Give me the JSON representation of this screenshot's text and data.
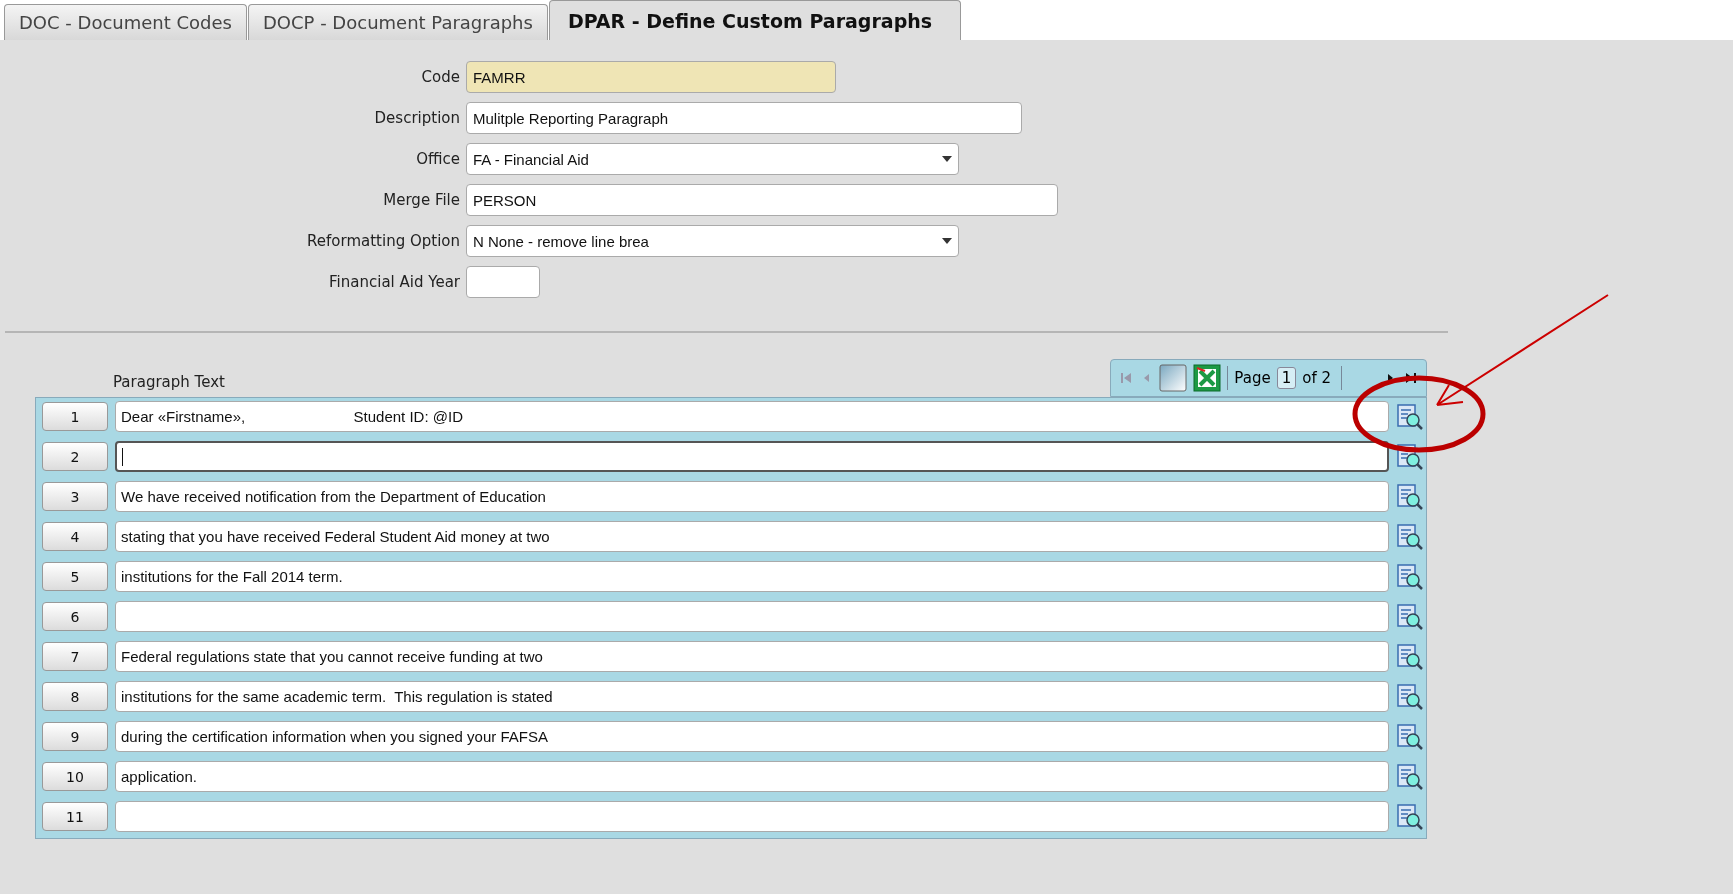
{
  "tabs": [
    {
      "label": "DOC - Document Codes",
      "selected": false
    },
    {
      "label": "DOCP - Document Paragraphs",
      "selected": false
    },
    {
      "label": "DPAR - Define Custom Paragraphs",
      "selected": true
    }
  ],
  "form": [
    {
      "label": "Code",
      "value": "FAMRR",
      "kind": "key"
    },
    {
      "label": "Description",
      "value": "Mulitple Reporting Paragraph",
      "kind": "text"
    },
    {
      "label": "Office",
      "value": "FA - Financial Aid",
      "kind": "select"
    },
    {
      "label": "Merge File",
      "value": "PERSON",
      "kind": "text"
    },
    {
      "label": "Reformatting Option",
      "value": "N None - remove line brea",
      "kind": "select"
    },
    {
      "label": "Financial Aid Year",
      "kind": "short"
    }
  ],
  "pager": {
    "label": "Page",
    "page": "1",
    "total": "of 2"
  },
  "grid": {
    "column": "Paragraph Text",
    "rows": [
      {
        "number": "1",
        "text": "Dear «Firstname»,                          Student ID: @ID",
        "focused": false
      },
      {
        "number": "2",
        "text": "",
        "focused": true
      },
      {
        "number": "3",
        "text": "We have received notification from the Department of Education",
        "focused": false
      },
      {
        "number": "4",
        "text": "stating that you have received Federal Student Aid money at two",
        "focused": false
      },
      {
        "number": "5",
        "text": "institutions for the Fall 2014 term.",
        "focused": false
      },
      {
        "number": "6",
        "text": "",
        "focused": false
      },
      {
        "number": "7",
        "text": "Federal regulations state that you cannot receive funding at two",
        "focused": false
      },
      {
        "number": "8",
        "text": "institutions for the same academic term.  This regulation is stated",
        "focused": false
      },
      {
        "number": "9",
        "text": "during the certification information when you signed your FAFSA",
        "focused": false
      },
      {
        "number": "10",
        "text": "application.",
        "focused": false
      },
      {
        "number": "11",
        "text": "",
        "focused": false
      }
    ]
  }
}
